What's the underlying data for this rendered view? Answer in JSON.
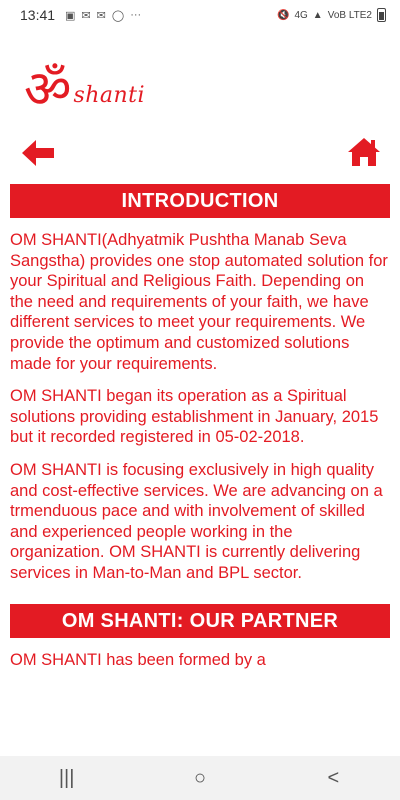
{
  "status_bar": {
    "time": "13:41",
    "left_icons": [
      "image-icon",
      "mail-icon",
      "email-icon",
      "instagram-icon"
    ],
    "more": "···",
    "network": "4G",
    "carrier": "VoB LTE2"
  },
  "logo": {
    "symbol": "ॐ",
    "text": "shanti"
  },
  "nav": {
    "back_icon": "back-arrow-icon",
    "home_icon": "home-icon",
    "accent": "#e31b23"
  },
  "sections": [
    {
      "title": "INTRODUCTION",
      "paragraphs": [
        "OM SHANTI(Adhyatmik Pushtha Manab Seva Sangstha) provides one stop automated solution for your Spiritual and Religious Faith. Depending on the need and requirements of your faith, we have different services to meet your requirements. We provide the optimum and customized solutions made for your requirements.",
        "OM SHANTI began its operation as a Spiritual solutions providing establishment in January, 2015 but it recorded registered in 05-02-2018.",
        "OM SHANTI is focusing exclusively in high quality and cost-effective services. We are advancing on a trmenduous pace and with involvement of skilled and experienced people working in the organization. OM SHANTI is currently delivering services in Man-to-Man and BPL sector."
      ]
    },
    {
      "title": "OM SHANTI: OUR PARTNER",
      "paragraphs": [
        "OM SHANTI has been formed by a"
      ]
    }
  ],
  "system_nav": {
    "recent": "|||",
    "home": "○",
    "back": "<"
  }
}
